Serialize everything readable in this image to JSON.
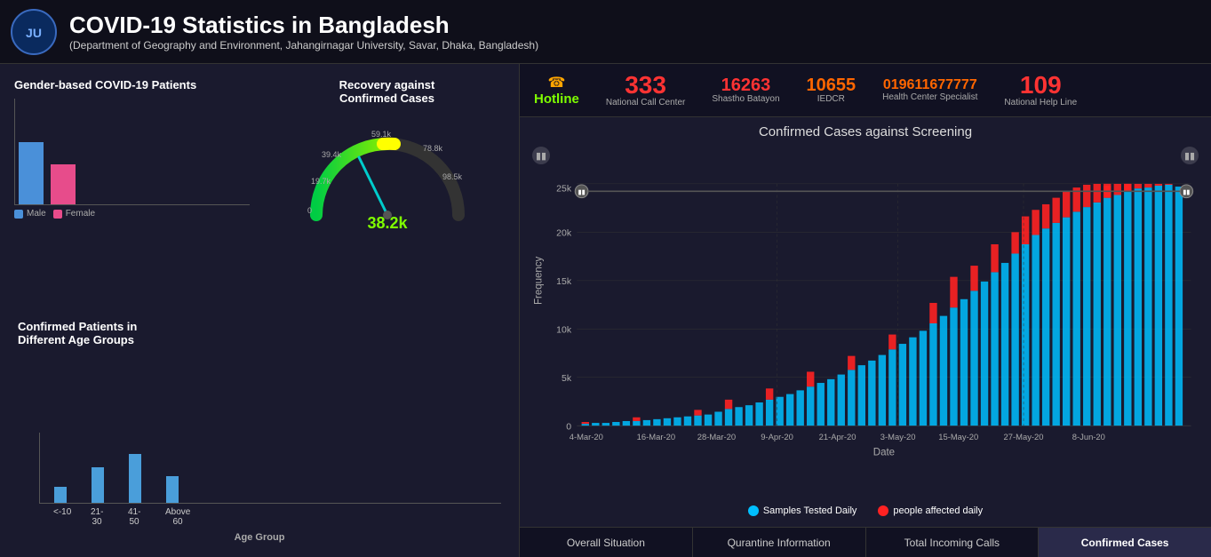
{
  "header": {
    "title": "COVID-19 Statistics in Bangladesh",
    "subtitle": "(Department of Geography and Environment, Jahangirnagar University, Savar, Dhaka, Bangladesh)"
  },
  "hotline": {
    "label": "Hotline",
    "items": [
      {
        "number": "333",
        "sub": "National Call Center",
        "size": "big"
      },
      {
        "number": "16263",
        "sub": "Shastho Batayon",
        "size": "med"
      },
      {
        "number": "10655",
        "sub": "IEDCR",
        "size": "med"
      },
      {
        "number": "019611677777",
        "sub": "Health Center Specialist",
        "size": "small"
      },
      {
        "number": "109",
        "sub": "National Help Line",
        "size": "big"
      }
    ]
  },
  "chart": {
    "title": "Confirmed Cases against Screening",
    "x_label": "Date",
    "y_label": "Frequency",
    "x_ticks": [
      "4-Mar-20",
      "16-Mar-20",
      "28-Mar-20",
      "9-Apr-20",
      "21-Apr-20",
      "3-May-20",
      "15-May-20",
      "27-May-20",
      "8-Jun-20"
    ],
    "y_ticks": [
      "0",
      "5k",
      "10k",
      "15k",
      "20k",
      "25k"
    ],
    "legend": [
      {
        "label": "Samples Tested Daily",
        "color": "#00bfff"
      },
      {
        "label": "people affected daily",
        "color": "#ff2222"
      }
    ]
  },
  "left": {
    "gender_title": "Gender-based COVID-19 Patients",
    "recovery_title": "Recovery against\nConfirmed Cases",
    "gauge_value": "38.2k",
    "gauge_labels": {
      "left2": "19.7k",
      "left1": "39.4k",
      "top": "59.1k",
      "right1": "78.8k",
      "right2": "98.5k",
      "bottom": "0"
    },
    "age_title": "Confirmed Patients in\nDifferent Age Groups",
    "age_axis": "Age Group",
    "age_groups": [
      "<-10",
      "21-30",
      "41-50",
      "Above 60"
    ]
  },
  "tabs": [
    {
      "label": "Overall Situation",
      "active": false
    },
    {
      "label": "Qurantine Information",
      "active": false
    },
    {
      "label": "Total Incoming Calls",
      "active": false
    },
    {
      "label": "Confirmed Cases",
      "active": true
    }
  ]
}
